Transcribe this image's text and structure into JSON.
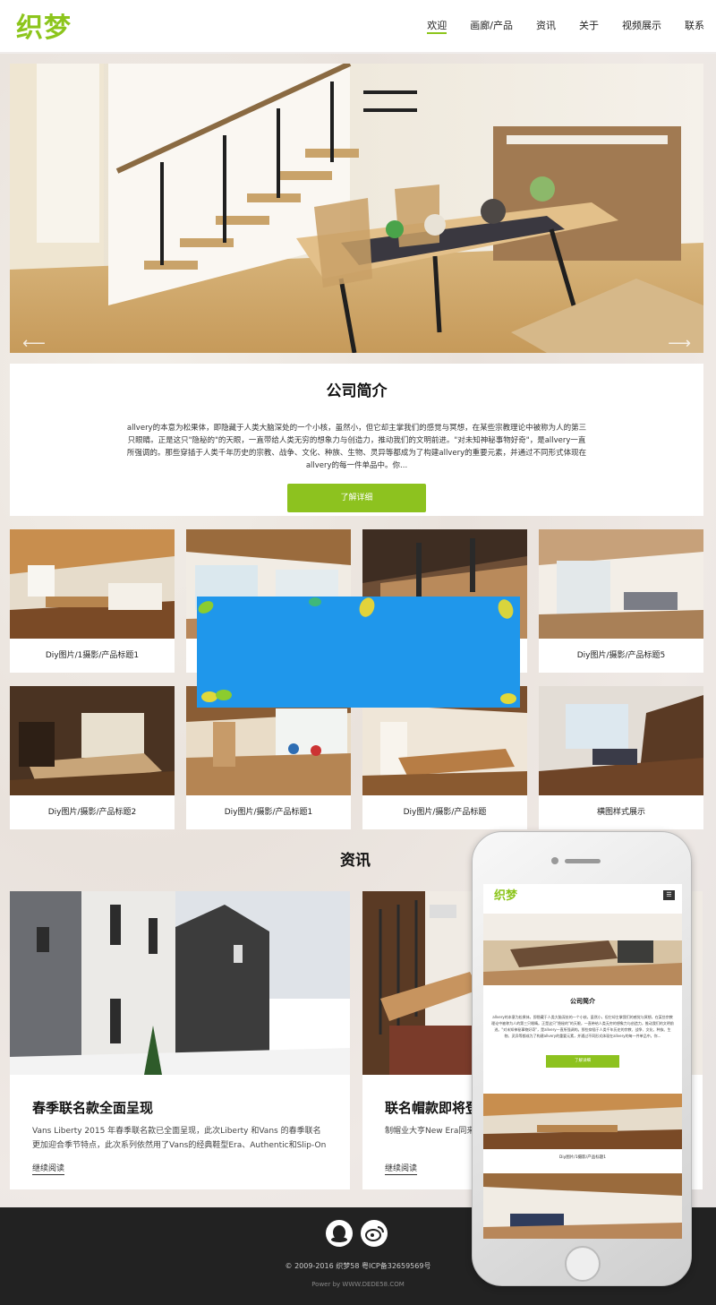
{
  "header": {
    "logo": "织梦",
    "nav": [
      "欢迎",
      "画廊/产品",
      "资讯",
      "关于",
      "视频展示",
      "联系"
    ]
  },
  "hero": {
    "prev_arrow": "⟵",
    "next_arrow": "⟶"
  },
  "about": {
    "title": "公司简介",
    "text": "allvery的本意为松果体，即隐藏于人类大脑深处的一个小核，虽然小，但它却主掌我们的感觉与冥想，在某些宗教理论中被称为人的第三只眼睛。正是这只\"隐秘的\"的天眼，一直带给人类无穷的想象力与创造力，推动我们的文明前进。\"对未知神秘事物好奇\"，是allvery一直所强调的。那些穿插于人类千年历史的宗教、战争、文化、种族、生物、灵异等都成为了构建allvery的重要元素，并通过不同形式体现在allvery的每一件单品中。你...",
    "button": "了解详细"
  },
  "gallery": {
    "row1": [
      "Diy图片/1摄影/产品标题1",
      "",
      "",
      "Diy图片/摄影/产品标题5"
    ],
    "row2": [
      "Diy图片/摄影/产品标题2",
      "Diy图片/摄影/产品标题1",
      "Diy图片/摄影/产品标题",
      "横图样式展示"
    ]
  },
  "news": {
    "title": "资讯",
    "items": [
      {
        "title": "春季联名款全面呈现",
        "text": "Vans Liberty 2015 年春季联名款已全面呈现，此次Liberty 和Vans 的春季联名更加迎合季节特点，此次系列依然用了Vans的经典鞋型Era、Authentic和Slip-On 作为",
        "more": "继续阅读"
      },
      {
        "title": "联名帽款即将登场",
        "text": "制帽业大亨New Era同来窕。该合作计划共涉及两",
        "more": "继续阅读"
      }
    ]
  },
  "footer": {
    "copyright": "© 2009-2016 织梦58 粤ICP备32659569号",
    "powered": "Power by WWW.DEDE58.COM"
  },
  "phone": {
    "logo": "织梦",
    "menu": "☰",
    "about_title": "公司简介",
    "about_text": "allvery的本意为松果体，即隐藏于人类大脑深处的一个小核，虽然小，但它却主掌我们的感觉与冥想，在某些宗教理论中被称为人的第三只眼睛。正是这只\"隐秘的\"的天眼，一直带给人类无穷的想象力与创造力，推动我们的文明前进。\"对未知神秘事物好奇\"，是allvery一直所强调的。那些穿插于人类千年历史的宗教、战争、文化、种族、生物、灵异等都成为了构建allvery的重要元素，并通过不同形式体现在allvery的每一件单品中。你...",
    "button": "了解详细",
    "caption": "Diy图片/1摄影/产品标题1"
  },
  "colors": {
    "accent": "#8dc21f",
    "popup": "#1f97eb",
    "footer": "#222222"
  }
}
